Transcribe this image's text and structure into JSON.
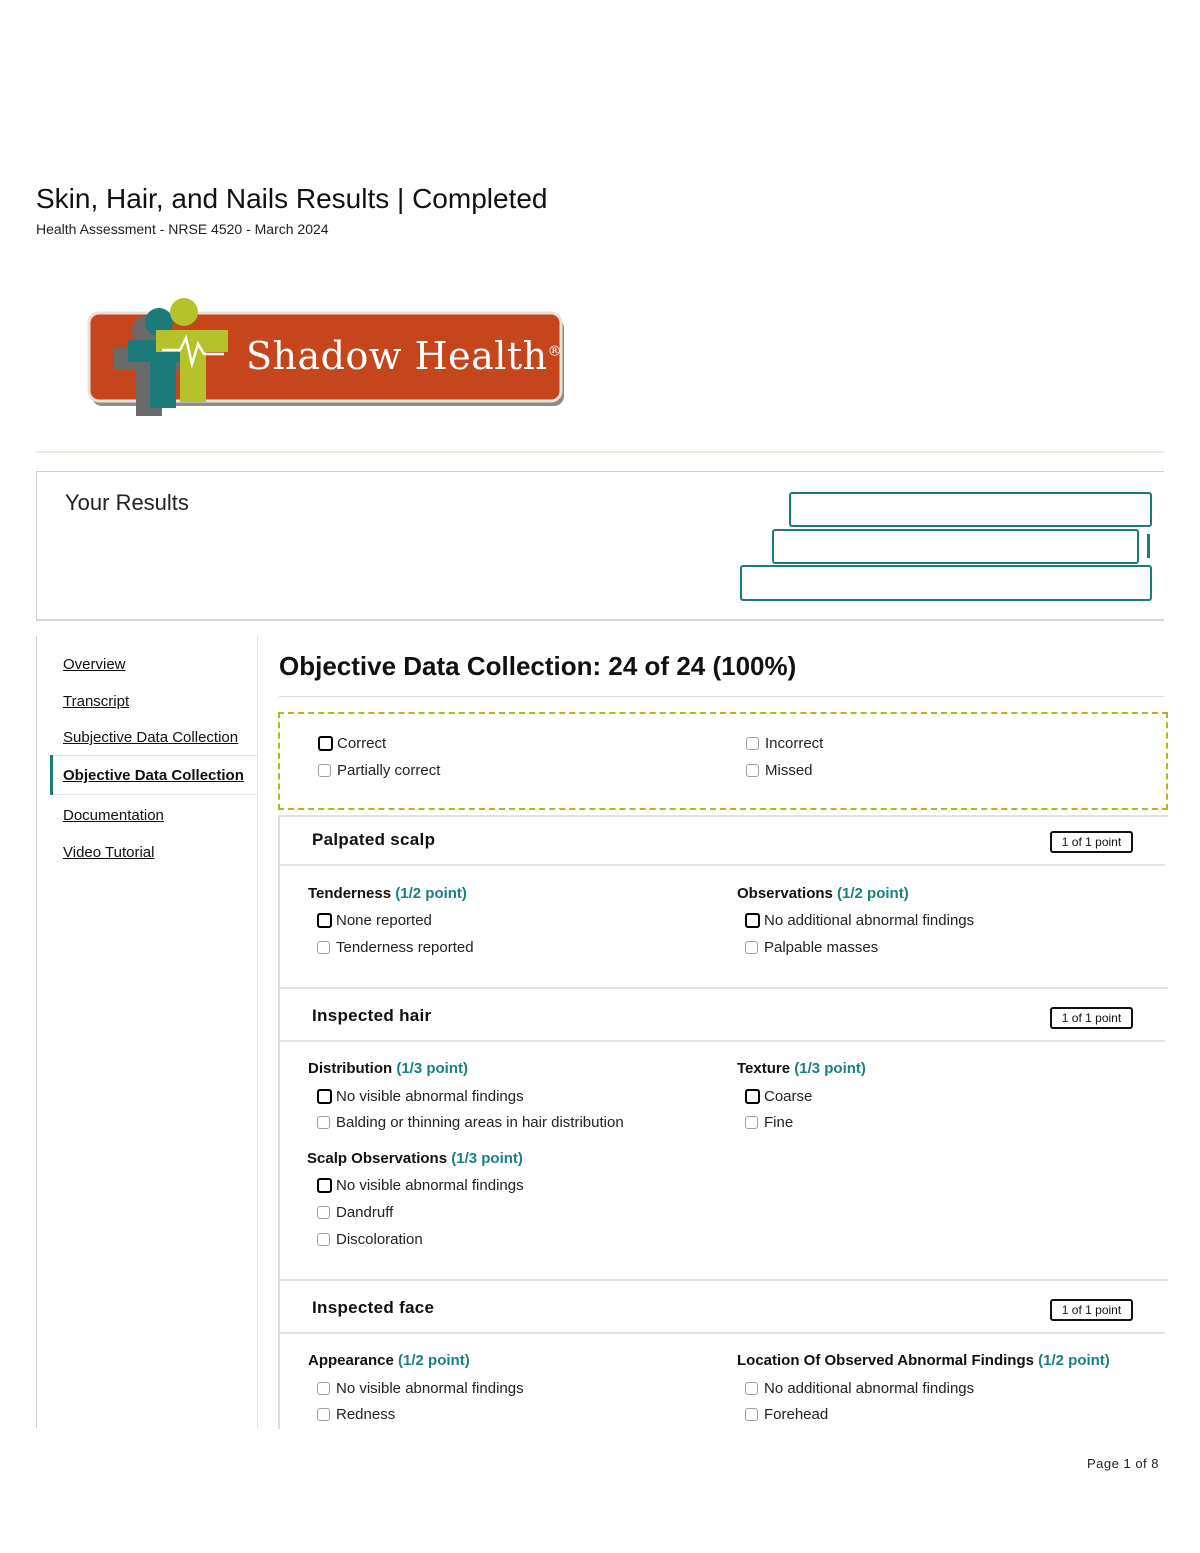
{
  "header": {
    "title": "Skin, Hair, and Nails Results | Completed",
    "subtitle": "Health Assessment - NRSE 4520 - March 2024"
  },
  "logo": {
    "text": "Shadow Health",
    "mark": "®",
    "brand_color": "#c5461c",
    "accent_color": "#b6c22a"
  },
  "results": {
    "title": "Your Results"
  },
  "nav": {
    "items": [
      {
        "label": "Overview"
      },
      {
        "label": "Transcript"
      },
      {
        "label": "Subjective Data Collection"
      },
      {
        "label": "Objective Data Collection",
        "active": true
      },
      {
        "label": "Documentation"
      },
      {
        "label": "Video Tutorial"
      }
    ]
  },
  "section": {
    "title": "Objective Data Collection: 24 of 24 (100%)"
  },
  "legend": {
    "correct": "Correct",
    "partially_correct": "Partially correct",
    "incorrect": "Incorrect",
    "missed": "Missed"
  },
  "cards": [
    {
      "title": "Palpated scalp",
      "badge": "1 of 1 point",
      "questions": [
        {
          "label": "Tenderness",
          "points": "(1/2 point)",
          "options": [
            "None reported",
            "Tenderness reported"
          ]
        },
        {
          "label": "Observations",
          "points": "(1/2 point)",
          "options": [
            "No additional abnormal findings",
            "Palpable masses"
          ]
        }
      ]
    },
    {
      "title": "Inspected hair",
      "badge": "1 of 1 point",
      "questions": [
        {
          "label": "Distribution",
          "points": "(1/3 point)",
          "options": [
            "No visible abnormal findings",
            "Balding or thinning areas in hair distribution"
          ]
        },
        {
          "label": "Texture",
          "points": "(1/3 point)",
          "options": [
            "Coarse",
            "Fine"
          ]
        },
        {
          "label": "Scalp Observations",
          "points": "(1/3 point)",
          "options": [
            "No visible abnormal findings",
            "Dandruff",
            "Discoloration"
          ]
        }
      ]
    },
    {
      "title": "Inspected face",
      "badge": "1 of 1 point",
      "questions": [
        {
          "label": "Appearance",
          "points": "(1/2 point)",
          "options": [
            "No visible abnormal findings",
            "Redness"
          ]
        },
        {
          "label": "Location Of Observed Abnormal Findings",
          "points": "(1/2 point)",
          "options": [
            "No additional abnormal findings",
            "Forehead"
          ]
        }
      ]
    }
  ],
  "footer": {
    "page": "Page 1 of 8"
  }
}
